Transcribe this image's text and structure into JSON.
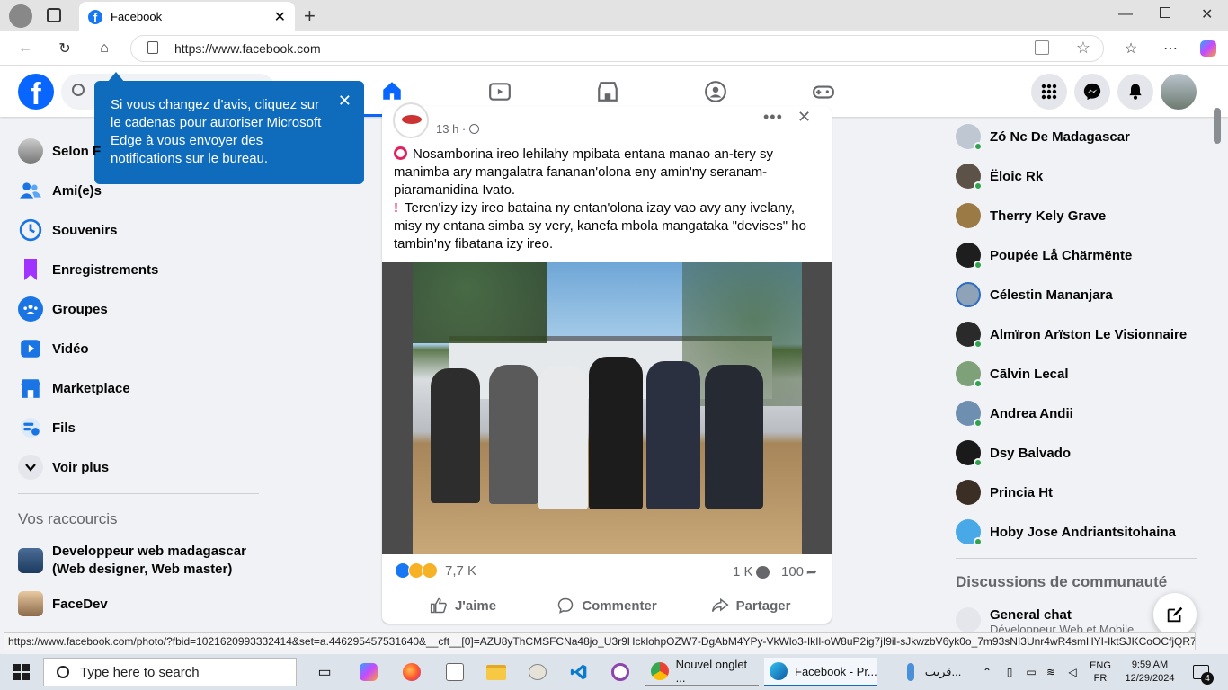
{
  "browser": {
    "tab_title": "Facebook",
    "url": "https://www.facebook.com",
    "status_url": "https://www.facebook.com/photo/?fbid=1021620993332414&set=a.446295457531640&__cft__[0]=AZU8yThCMSFCNa48jo_U3r9HcklohpOZW7-DgAbM4YPy-VkWlo3-IkIl-oW8uP2ig7jI9il-sJkwzbV6yk0o_7m93sNI3Unr4wR4smHYI-IktSJKCoOCfjQR7k2..."
  },
  "tooltip": {
    "text": "Si vous changez d'avis, cliquez sur le cadenas pour autoriser Microsoft Edge à vous envoyer des notifications sur le bureau."
  },
  "left_nav": {
    "items": [
      {
        "label": "Selon F"
      },
      {
        "label": "Ami(e)s"
      },
      {
        "label": "Souvenirs"
      },
      {
        "label": "Enregistrements"
      },
      {
        "label": "Groupes"
      },
      {
        "label": "Vidéo"
      },
      {
        "label": "Marketplace"
      },
      {
        "label": "Fils"
      },
      {
        "label": "Voir plus"
      }
    ],
    "shortcuts_title": "Vos raccourcis",
    "shortcuts": [
      {
        "label": "Developpeur web madagascar (Web designer, Web master)"
      },
      {
        "label": "FaceDev"
      }
    ]
  },
  "post": {
    "time": "13 h ·",
    "text_line1": "Nosamborina ireo lehilahy mpibata entana manao an-tery sy manimba ary mangalatra fananan'olona eny amin'ny seranam-piaramanidina Ivato.",
    "text_line2": "Teren'izy izy ireo bataina ny entan'olona izay vao avy any ivelany, misy ny entana simba sy very, kanefa mbola mangataka \"devises\" ho tambin'ny fibatana izy ireo.",
    "reactions_count": "7,7 K",
    "comments_count": "1 K",
    "shares_count": "100",
    "like_label": "J'aime",
    "comment_label": "Commenter",
    "share_label": "Partager"
  },
  "contacts": [
    {
      "name": "Zó Nc De Madagascar"
    },
    {
      "name": "Ëloic Rk"
    },
    {
      "name": "Therry Kely Grave"
    },
    {
      "name": "Poupée Lå Chärmënte"
    },
    {
      "name": "Célestin Mananjara"
    },
    {
      "name": "Almïron Arïston Le Visionnaire"
    },
    {
      "name": "Cālvin Lecal"
    },
    {
      "name": "Andrea Andii"
    },
    {
      "name": "Dsy Balvado"
    },
    {
      "name": "Princia Ht"
    },
    {
      "name": "Hoby Jose Andriantsitohaina"
    }
  ],
  "community": {
    "title": "Discussions de communauté",
    "chat_name": "General chat",
    "chat_sub": "Développeur Web et Mobile"
  },
  "taskbar": {
    "search_placeholder": "Type here to search",
    "app1": "Nouvel onglet ...",
    "app2": "Facebook - Pr...",
    "weather": "قريب...",
    "lang1": "ENG",
    "lang2": "FR",
    "time": "9:59 AM",
    "date": "12/29/2024",
    "notif_count": "4"
  }
}
